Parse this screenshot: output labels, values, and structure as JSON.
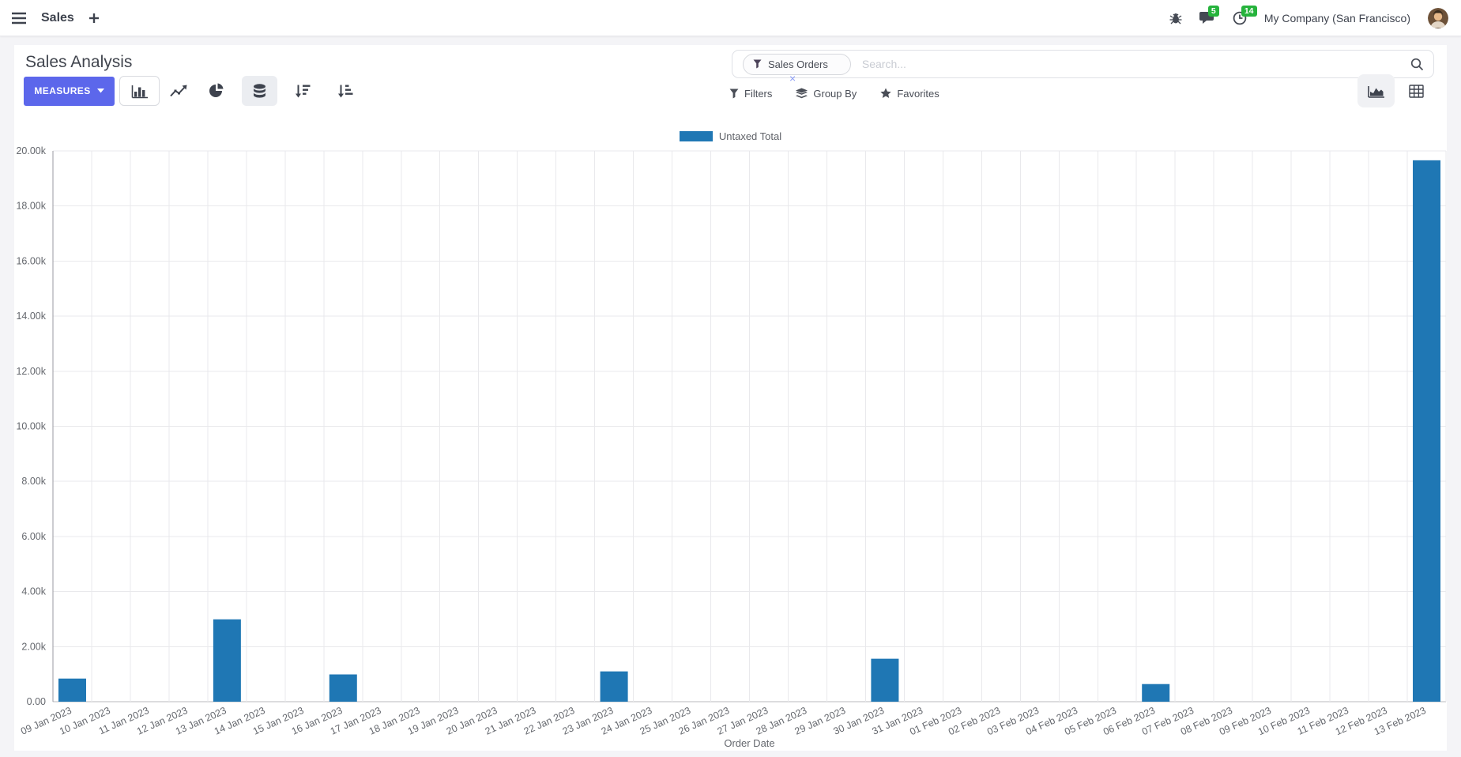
{
  "navbar": {
    "app_name": "Sales",
    "messages_badge": "5",
    "activities_badge": "14",
    "company": "My Company (San Francisco)"
  },
  "control_panel": {
    "title": "Sales Analysis",
    "measures_label": "MEASURES",
    "search": {
      "facet": "Sales Orders",
      "facet_remove": "×",
      "placeholder": "Search..."
    },
    "filters_label": "Filters",
    "groupby_label": "Group By",
    "favorites_label": "Favorites"
  },
  "colors": {
    "accent": "#5C67EB",
    "bar": "#1f77b4",
    "badge_green": "#26b33c"
  },
  "chart_data": {
    "type": "bar",
    "title": "",
    "xlabel": "Order Date",
    "ylabel": "",
    "ylim": [
      0,
      20000
    ],
    "ytick_step": 2000,
    "ytick_labels": [
      "0.00",
      "2.00k",
      "4.00k",
      "6.00k",
      "8.00k",
      "10.00k",
      "12.00k",
      "14.00k",
      "16.00k",
      "18.00k",
      "20.00k"
    ],
    "grid": true,
    "legend_position": "top",
    "series_color": "#1f77b4",
    "categories": [
      "09 Jan 2023",
      "10 Jan 2023",
      "11 Jan 2023",
      "12 Jan 2023",
      "13 Jan 2023",
      "14 Jan 2023",
      "15 Jan 2023",
      "16 Jan 2023",
      "17 Jan 2023",
      "18 Jan 2023",
      "19 Jan 2023",
      "20 Jan 2023",
      "21 Jan 2023",
      "22 Jan 2023",
      "23 Jan 2023",
      "24 Jan 2023",
      "25 Jan 2023",
      "26 Jan 2023",
      "27 Jan 2023",
      "28 Jan 2023",
      "29 Jan 2023",
      "30 Jan 2023",
      "31 Jan 2023",
      "01 Feb 2023",
      "02 Feb 2023",
      "03 Feb 2023",
      "04 Feb 2023",
      "05 Feb 2023",
      "06 Feb 2023",
      "07 Feb 2023",
      "08 Feb 2023",
      "09 Feb 2023",
      "10 Feb 2023",
      "11 Feb 2023",
      "12 Feb 2023",
      "13 Feb 2023"
    ],
    "series": [
      {
        "name": "Untaxed Total",
        "values": [
          840,
          0,
          0,
          0,
          2990,
          0,
          0,
          990,
          0,
          0,
          0,
          0,
          0,
          0,
          1100,
          0,
          0,
          0,
          0,
          0,
          0,
          1560,
          0,
          0,
          0,
          0,
          0,
          0,
          640,
          0,
          0,
          0,
          0,
          0,
          0,
          19660
        ]
      }
    ]
  }
}
